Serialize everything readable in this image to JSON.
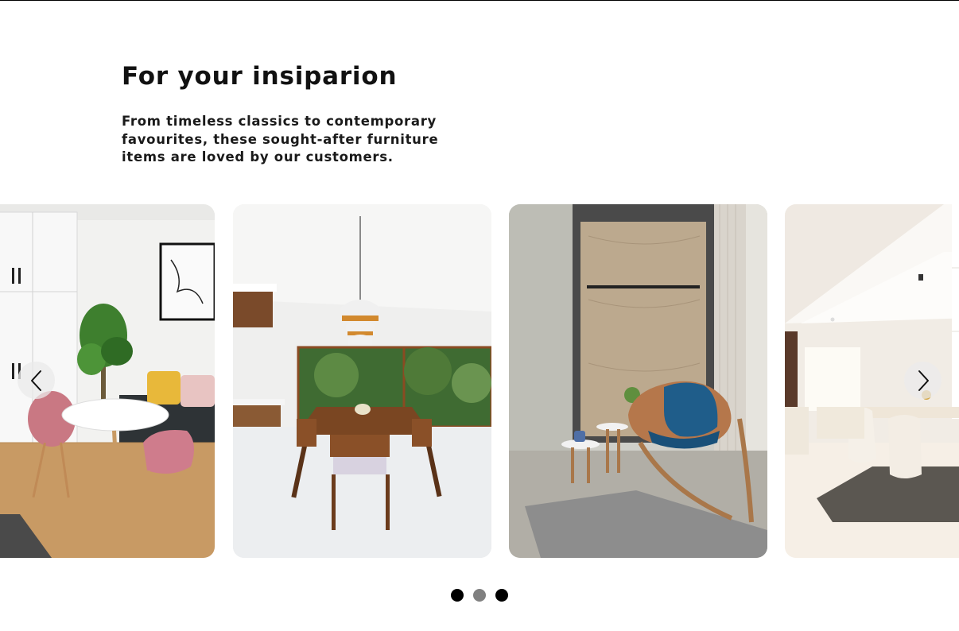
{
  "section": {
    "heading": "For your insiparion",
    "subtext": "From timeless classics to contemporary favourites, these sought-after furniture items are loved by our customers."
  },
  "carousel": {
    "slides": [
      {
        "icon": "dining-room-pink-chairs-image"
      },
      {
        "icon": "dining-room-pendant-lamp-image"
      },
      {
        "icon": "blue-shell-chair-image"
      },
      {
        "icon": "open-living-dining-room-image"
      }
    ],
    "prev_icon": "chevron-left-icon",
    "next_icon": "chevron-right-icon",
    "dots": [
      {
        "state": "inactive",
        "color": "#000000"
      },
      {
        "state": "active",
        "color": "#808080"
      },
      {
        "state": "inactive",
        "color": "#000000"
      }
    ]
  },
  "colors": {
    "text": "#111111",
    "nav_button_bg": "#ebebeb"
  }
}
